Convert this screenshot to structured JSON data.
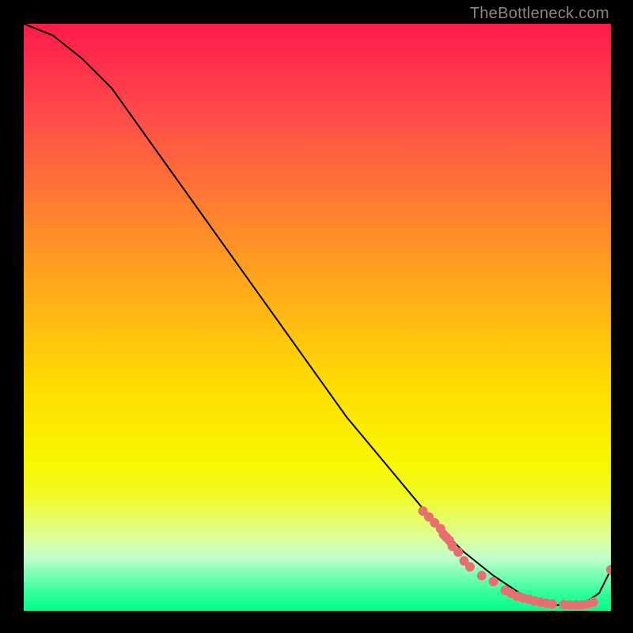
{
  "watermark": "TheBottleneck.com",
  "chart_data": {
    "type": "line",
    "title": "",
    "xlabel": "",
    "ylabel": "",
    "xlim": [
      0,
      100
    ],
    "ylim": [
      0,
      100
    ],
    "curve": {
      "x": [
        0,
        5,
        10,
        15,
        20,
        25,
        30,
        35,
        40,
        45,
        50,
        55,
        60,
        65,
        70,
        75,
        80,
        83,
        86,
        89,
        92,
        95,
        98,
        100
      ],
      "y": [
        100,
        98,
        94,
        89,
        82,
        75,
        68,
        61,
        54,
        47,
        40,
        33,
        27,
        21,
        15,
        10,
        6,
        4,
        2,
        1,
        1,
        1,
        3,
        7
      ]
    },
    "markers": {
      "x": [
        68,
        69,
        70,
        71,
        71.5,
        72,
        72.5,
        73,
        74,
        75,
        76,
        78,
        80,
        82,
        83,
        84,
        85,
        86,
        87,
        88,
        89,
        90,
        92,
        93,
        94,
        95,
        96,
        97,
        100
      ],
      "y": [
        17,
        16,
        15,
        14,
        13,
        12.5,
        12,
        11,
        10,
        8.5,
        7.5,
        6,
        5,
        3.5,
        3,
        2.5,
        2.2,
        2,
        1.7,
        1.5,
        1.3,
        1.2,
        1.1,
        1,
        1,
        1,
        1.2,
        1.5,
        7
      ],
      "color": "#e76f6f"
    }
  }
}
